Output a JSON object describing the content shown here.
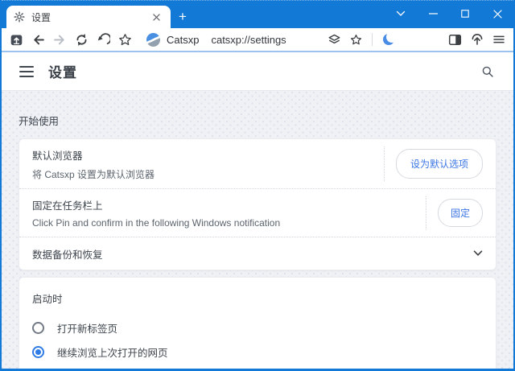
{
  "colors": {
    "titlebar_blue": "#1279d6",
    "toolbar_divider_blue": "#9cc2ee",
    "button_text_blue": "#3b76e4",
    "radio_checked_blue": "#2e7ce4",
    "content_background": "#eff1f5"
  },
  "titlebar": {
    "tab": {
      "favicon": "gear-icon",
      "title": "设置"
    },
    "new_tab_glyph": "+",
    "controls": [
      "chevron-down",
      "minimize",
      "maximize",
      "close"
    ]
  },
  "toolbar": {
    "left_icons": [
      "upload-box-icon",
      "back-icon",
      "forward-icon",
      "refresh-icon",
      "undo-icon",
      "star-icon"
    ],
    "site_chip": "Catsxp",
    "url": "catsxp://settings",
    "right_icons": [
      "layers-icon",
      "bookmark-star-icon",
      "moon-icon",
      "sidebar-icon",
      "download-dome-icon",
      "menu-icon"
    ]
  },
  "header": {
    "menu_icon": "hamburger-icon",
    "title": "设置",
    "search_icon": "search-icon"
  },
  "content": {
    "section_label": "开始使用",
    "card1": {
      "rows": [
        {
          "title": "默认浏览器",
          "subtitle": "将 Catsxp 设置为默认浏览器",
          "button": "设为默认选项"
        },
        {
          "title": "固定在任务栏上",
          "subtitle": "Click Pin and confirm in the following Windows notification",
          "button": "固定"
        },
        {
          "title": "数据备份和恢复",
          "trailing_icon": "chevron-down-icon"
        }
      ]
    },
    "card2": {
      "label": "启动时",
      "options": [
        {
          "label": "打开新标签页",
          "selected": false
        },
        {
          "label": "继续浏览上次打开的网页",
          "selected": true
        }
      ]
    }
  }
}
